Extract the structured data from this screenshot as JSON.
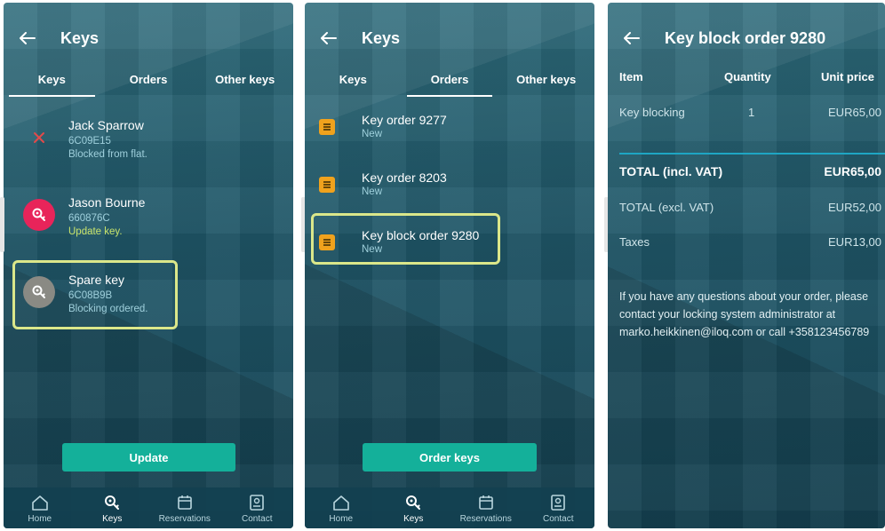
{
  "screens": {
    "keys_list": {
      "title": "Keys",
      "tabs": [
        "Keys",
        "Orders",
        "Other keys"
      ],
      "active_tab": "Keys",
      "items": [
        {
          "name": "Jack Sparrow",
          "code": "6C09E15",
          "status": "Blocked from flat.",
          "avatar": "blocked-x-icon"
        },
        {
          "name": "Jason Bourne",
          "code": "660876C",
          "status": "Update key.",
          "avatar": "key-icon"
        },
        {
          "name": "Spare key",
          "code": "6C08B9B",
          "status": "Blocking ordered.",
          "avatar": "key-icon"
        }
      ],
      "button": "Update"
    },
    "orders_list": {
      "title": "Keys",
      "tabs": [
        "Keys",
        "Orders",
        "Other keys"
      ],
      "active_tab": "Orders",
      "orders": [
        {
          "name": "Key order 9277",
          "status": "New"
        },
        {
          "name": "Key order 8203",
          "status": "New"
        },
        {
          "name": "Key block order 9280",
          "status": "New"
        }
      ],
      "button": "Order keys"
    },
    "order_detail": {
      "title": "Key block order 9280",
      "columns": [
        "Item",
        "Quantity",
        "Unit price"
      ],
      "line": {
        "item": "Key blocking",
        "quantity": "1",
        "unit_price": "EUR65,00"
      },
      "total_incl": {
        "label": "TOTAL (incl. VAT)",
        "value": "EUR65,00"
      },
      "total_excl": {
        "label": "TOTAL (excl. VAT)",
        "value": "EUR52,00"
      },
      "taxes": {
        "label": "Taxes",
        "value": "EUR13,00"
      },
      "note": "If you have any questions about your order, please contact your locking system administrator at marko.heikkinen@iloq.com or call +358123456789"
    }
  },
  "nav": [
    "Home",
    "Keys",
    "Reservations",
    "Contact"
  ],
  "colors": {
    "accent": "#14b09a",
    "highlight": "#dbe78a",
    "update_status": "#c8e36b",
    "order_icon": "#f0a21d",
    "blocked_x": "#e24a4a",
    "avatar_red": "#e8245a",
    "avatar_gray": "#8a8a84",
    "divider": "#1ea6c4"
  }
}
